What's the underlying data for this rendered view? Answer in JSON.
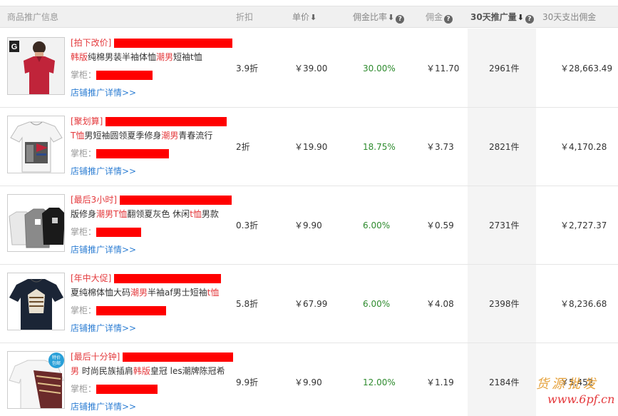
{
  "header": {
    "product_info": "商品推广信息",
    "discount": "折扣",
    "unit_price": "单价",
    "commission_rate": "佣金比率",
    "commission": "佣金",
    "promo_volume_30d": "30天推广量",
    "spend_30d": "30天支出佣金"
  },
  "rows": [
    {
      "tag": "[拍下改价]",
      "title_parts": [
        [
          "韩版",
          true
        ],
        [
          "纯棉男装半袖体恤",
          false
        ],
        [
          "潮男",
          true
        ],
        [
          "短袖t恤",
          false
        ]
      ],
      "owner_label": "掌柜：",
      "link": "店铺推广详情>>",
      "discount": "3.9折",
      "price": "￥39.00",
      "rate": "30.00%",
      "commission": "￥11.70",
      "volume": "2961件",
      "spend": "￥28,663.49"
    },
    {
      "tag": "[聚划算]",
      "title_parts": [
        [
          "T恤",
          true
        ],
        [
          "男短袖圆领夏季修身",
          false
        ],
        [
          "潮男",
          true
        ],
        [
          "青春流行",
          false
        ]
      ],
      "owner_label": "掌柜：",
      "link": "店铺推广详情>>",
      "discount": "2折",
      "price": "￥19.90",
      "rate": "18.75%",
      "commission": "￥3.73",
      "volume": "2821件",
      "spend": "￥4,170.28"
    },
    {
      "tag": "[最后3小时]",
      "title_parts": [
        [
          "版修身",
          false
        ],
        [
          "潮男T恤",
          true
        ],
        [
          "翻领夏灰色 休闲",
          false
        ],
        [
          "t恤",
          true
        ],
        [
          "男款",
          false
        ]
      ],
      "owner_label": "掌柜：",
      "link": "店铺推广详情>>",
      "discount": "0.3折",
      "price": "￥9.90",
      "rate": "6.00%",
      "commission": "￥0.59",
      "volume": "2731件",
      "spend": "￥2,727.37"
    },
    {
      "tag": "[年中大促]",
      "title_parts": [
        [
          "夏纯棉体恤大码",
          false
        ],
        [
          "潮男",
          true
        ],
        [
          "半袖af男士短袖",
          false
        ],
        [
          "t恤",
          true
        ]
      ],
      "owner_label": "掌柜：",
      "link": "店铺推广详情>>",
      "discount": "5.8折",
      "price": "￥67.99",
      "rate": "6.00%",
      "commission": "￥4.08",
      "volume": "2398件",
      "spend": "￥8,236.68"
    },
    {
      "tag": "[最后十分钟]",
      "title_parts": [
        [
          "男",
          true
        ],
        [
          " 时尚民族插肩",
          false
        ],
        [
          "韩版",
          true
        ],
        [
          "皇冠 les潮牌陈冠希",
          false
        ]
      ],
      "owner_label": "掌柜：",
      "link": "店铺推广详情>>",
      "discount": "9.9折",
      "price": "￥9.90",
      "rate": "12.00%",
      "commission": "￥1.19",
      "volume": "2184件",
      "spend": "￥5,452"
    }
  ],
  "thumbs": [
    {
      "icon": "red-polo-shirt-photo",
      "shirt_color": "#c0243a",
      "logo": "G"
    },
    {
      "icon": "white-printed-tshirt-photo",
      "shirt_color": "#f4f4f4"
    },
    {
      "icon": "three-polo-shirts-photo",
      "shirt_color": "#e8e8e8"
    },
    {
      "icon": "navy-feather-tshirt-photo",
      "shirt_color": "#1b2536"
    },
    {
      "icon": "white-ethnic-tshirt-photo",
      "shirt_color": "#f5f5f5",
      "badge": "特价包邮"
    }
  ],
  "watermark": {
    "line1": "货源批发",
    "line2": "www.6pf.cn"
  },
  "colors": {
    "tag_red": "#e4393c",
    "link_blue": "#2d7ed3",
    "rate_green": "#2e8b2e",
    "redaction": "#ff0000"
  }
}
